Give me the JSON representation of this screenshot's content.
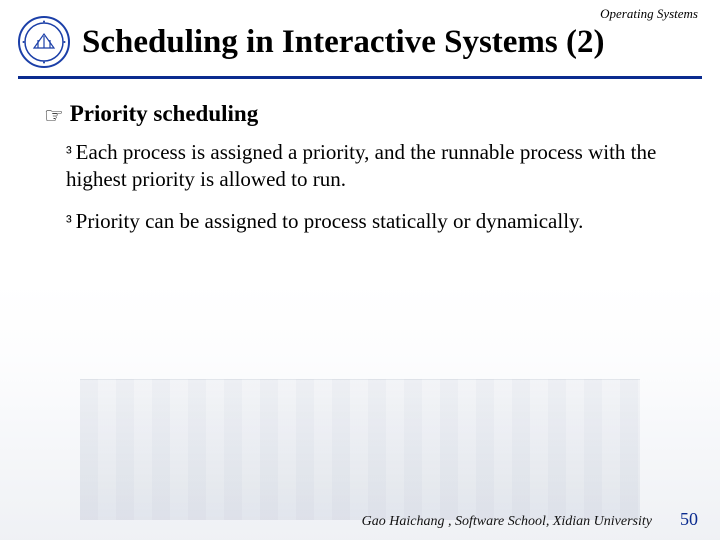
{
  "header": {
    "course": "Operating Systems",
    "title": "Scheduling in Interactive Systems (2)",
    "logo_name": "university-seal-icon"
  },
  "bullets": {
    "level1": {
      "glyph": "☞",
      "items": [
        {
          "text": "Priority scheduling"
        }
      ]
    },
    "level2": {
      "glyph": "³",
      "items": [
        {
          "text": "Each process is assigned a priority, and the runnable process with the highest priority is allowed to run."
        },
        {
          "text": "Priority can be assigned to process statically or dynamically."
        }
      ]
    }
  },
  "footer": {
    "attribution": "Gao Haichang , Software School, Xidian University",
    "page": "50"
  },
  "colors": {
    "rule": "#0a2b8f",
    "pagenum": "#0a2b8f"
  }
}
